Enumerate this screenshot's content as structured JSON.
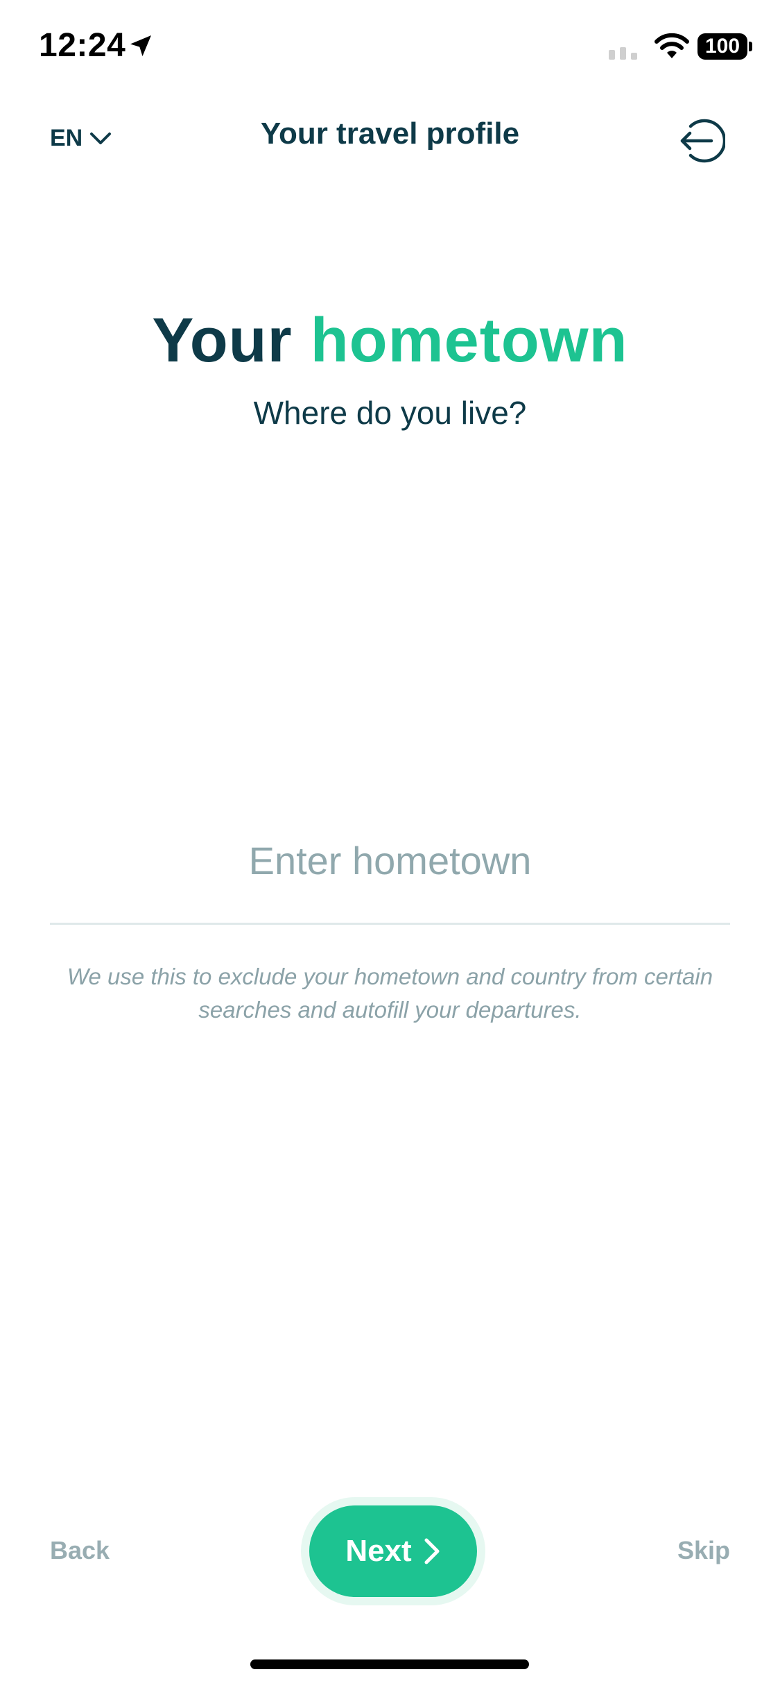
{
  "status_bar": {
    "time": "12:24",
    "battery": "100"
  },
  "header": {
    "language": "EN",
    "title": "Your travel profile"
  },
  "main": {
    "headline_part1": "Your",
    "headline_part2": "hometown",
    "subheadline": "Where do you live?",
    "input_placeholder": "Enter hometown",
    "input_value": "",
    "helper_text": "We use this to exclude your hometown and country from certain searches and autofill your departures."
  },
  "footer": {
    "back_label": "Back",
    "next_label": "Next",
    "skip_label": "Skip"
  },
  "colors": {
    "primary_text": "#0e3a48",
    "accent": "#1dc391",
    "muted": "#98adb2"
  },
  "icons": {
    "location": "location-arrow-icon",
    "signal": "cellular-signal-icon",
    "wifi": "wifi-icon",
    "language_dropdown": "chevron-down-icon",
    "exit": "exit-arrow-icon",
    "next": "chevron-right-icon"
  }
}
